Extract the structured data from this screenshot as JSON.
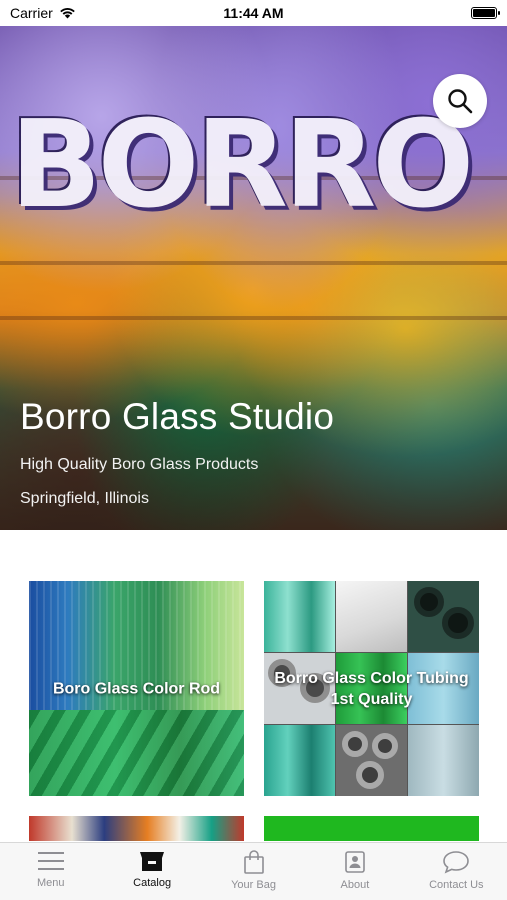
{
  "status": {
    "carrier": "Carrier",
    "time": "11:44 AM"
  },
  "hero": {
    "title": "Borro Glass Studio",
    "subtitle": "High Quality Boro Glass Products",
    "location": "Springfield, Illinois"
  },
  "search": {
    "icon": "search-icon"
  },
  "categories": [
    {
      "label": "Boro Glass Color Rod"
    },
    {
      "label": "Borro Glass Color Tubing 1st Quality"
    }
  ],
  "tabs": [
    {
      "label": "Menu",
      "icon": "menu-icon",
      "active": false
    },
    {
      "label": "Catalog",
      "icon": "catalog-box-icon",
      "active": true
    },
    {
      "label": "Your Bag",
      "icon": "bag-icon",
      "active": false
    },
    {
      "label": "About",
      "icon": "about-person-icon",
      "active": false
    },
    {
      "label": "Contact Us",
      "icon": "chat-bubble-icon",
      "active": false
    }
  ]
}
